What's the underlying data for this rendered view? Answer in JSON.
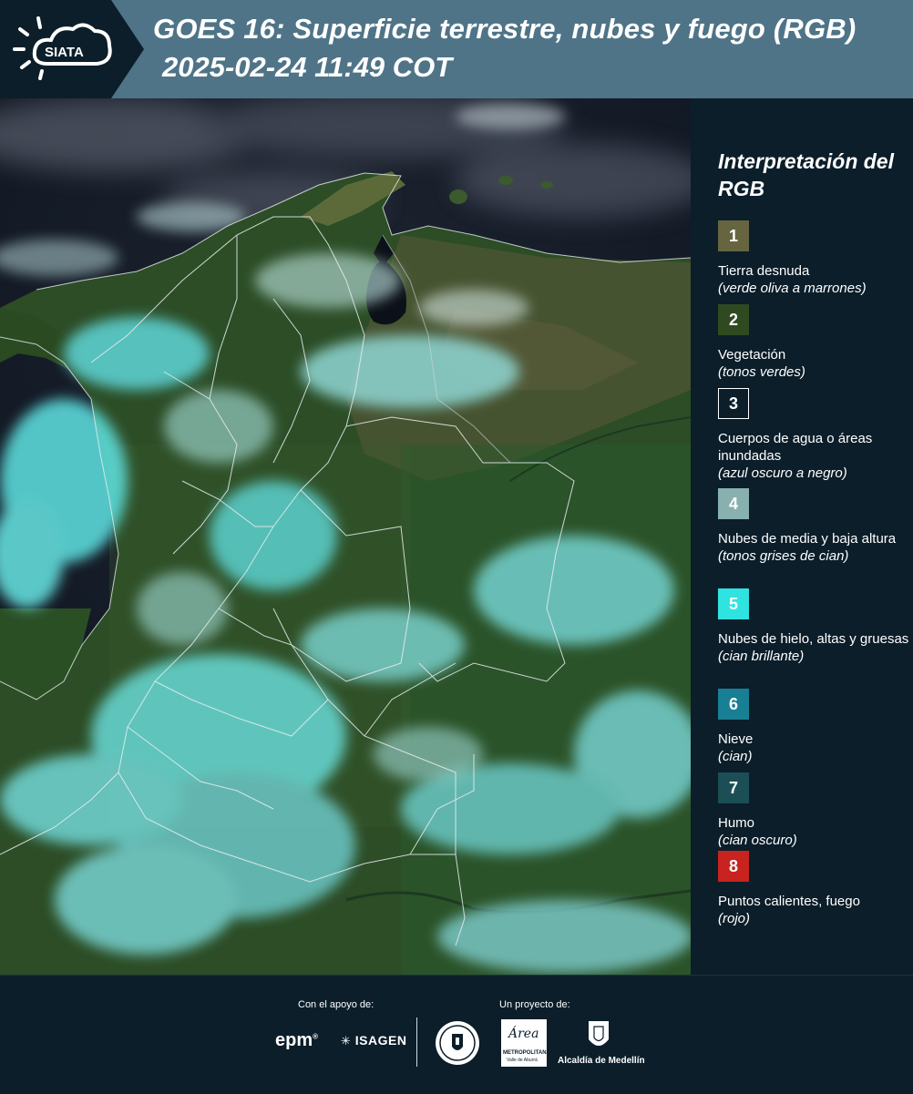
{
  "header": {
    "logo_text": "SIATA",
    "title_line1": "GOES 16: Superficie terrestre, nubes y fuego (RGB)",
    "title_line2": "2025-02-24 11:49 COT"
  },
  "legend": {
    "title": "Interpretación del RGB",
    "items": [
      {
        "number": "1",
        "color": "#66653f",
        "label": "Tierra desnuda",
        "desc": "(verde oliva a marrones)"
      },
      {
        "number": "2",
        "color": "#2f4a20",
        "label": "Vegetación",
        "desc": "(tonos verdes)"
      },
      {
        "number": "3",
        "color": "#0b1e2a",
        "label": "Cuerpos de agua o áreas inundadas",
        "desc": "(azul oscuro a negro)"
      },
      {
        "number": "4",
        "color": "#87b0ae",
        "label": "Nubes de media y baja altura",
        "desc": "(tonos grises de cian)"
      },
      {
        "number": "5",
        "color": "#2fe3e0",
        "label": "Nubes de hielo, altas y gruesas",
        "desc": "(cian brillante)"
      },
      {
        "number": "6",
        "color": "#197f94",
        "label": "Nieve",
        "desc": "(cian)"
      },
      {
        "number": "7",
        "color": "#1b4f55",
        "label": "Humo",
        "desc": "(cian oscuro)"
      },
      {
        "number": "8",
        "color": "#c8231f",
        "label": "Puntos calientes, fuego",
        "desc": "(rojo)"
      }
    ]
  },
  "footer": {
    "support_label": "Con el apoyo de:",
    "project_label": "Un proyecto de:",
    "sponsor1": "epm",
    "sponsor2": "ISAGEN",
    "partner_metro": "Área",
    "partner_metro_sub1": "METROPOLITANA",
    "partner_metro_sub2": "Valle de Aburrá",
    "partner_alcaldia": "Alcaldía de Medellín"
  }
}
